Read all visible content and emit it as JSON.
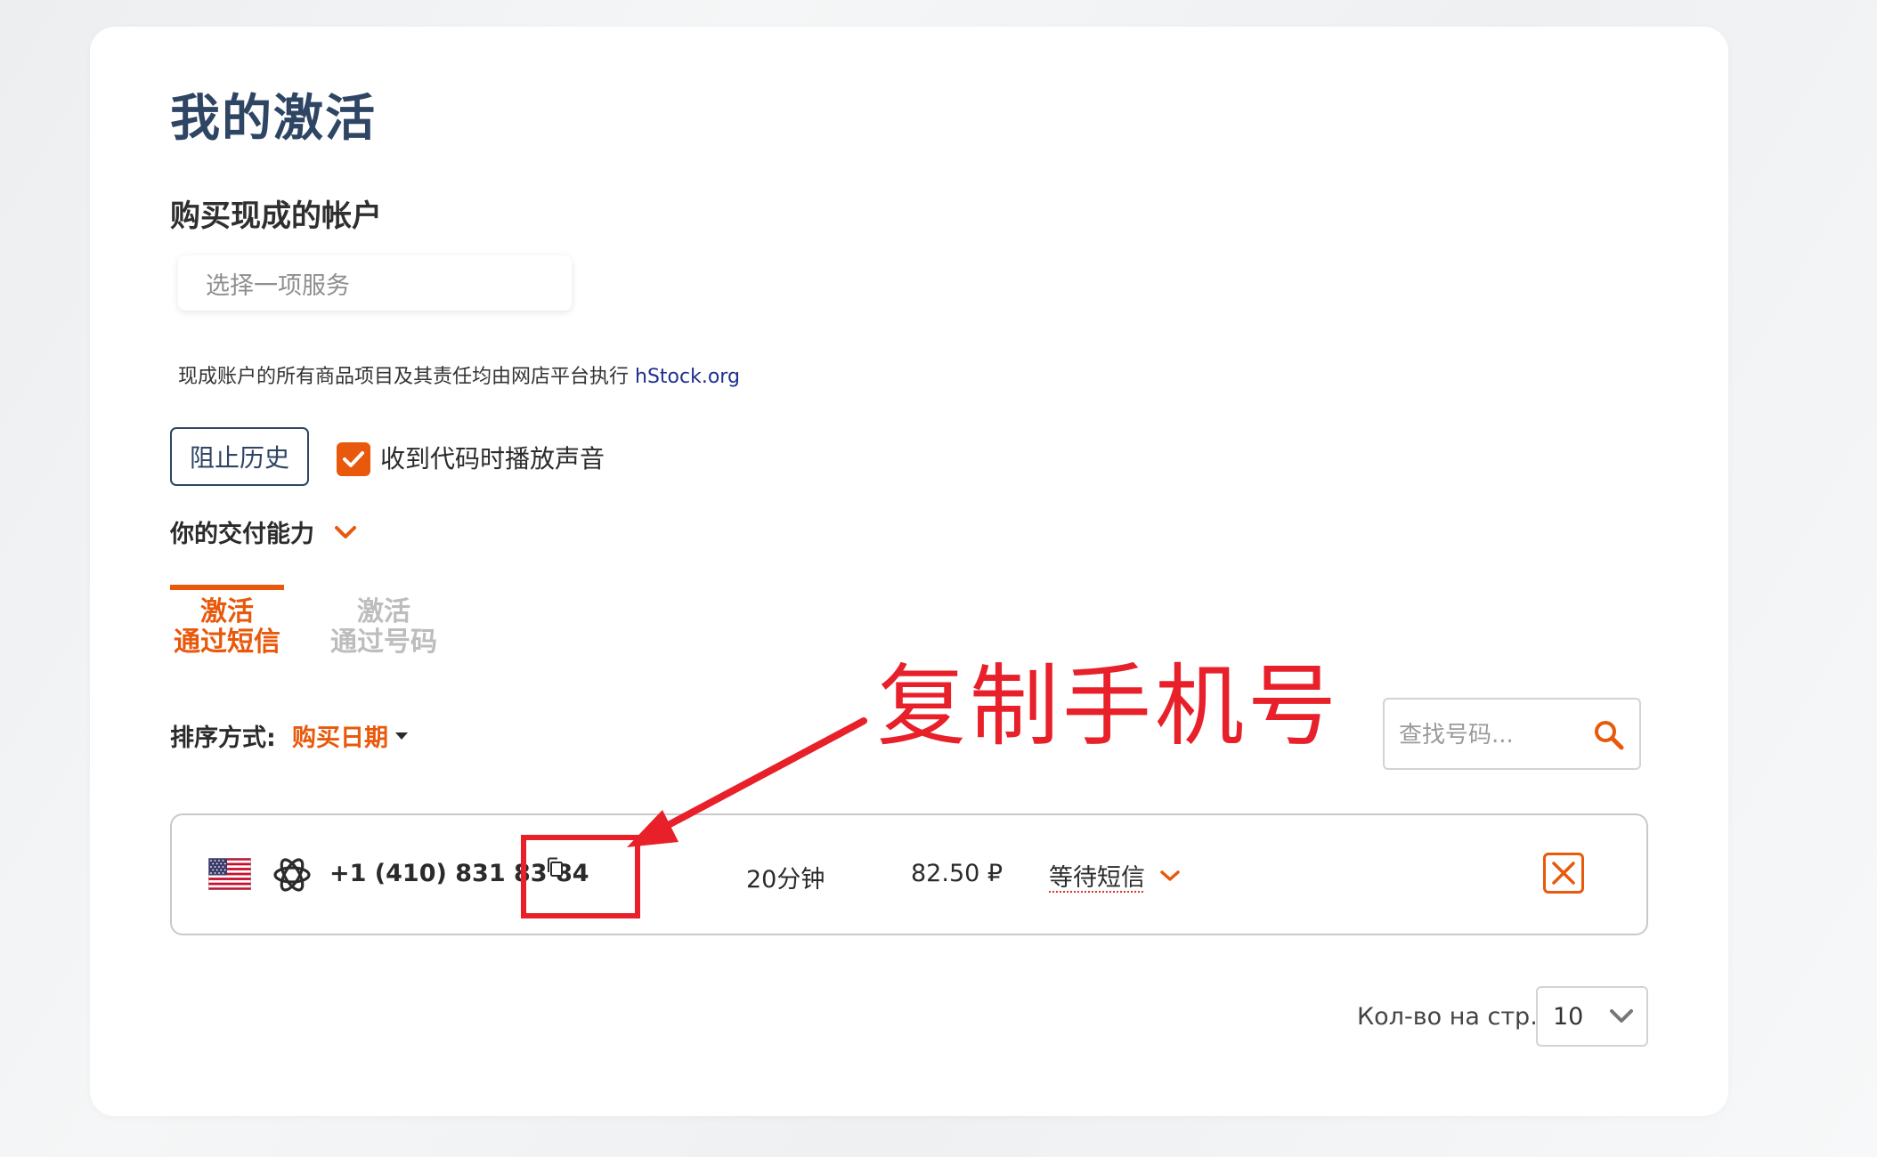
{
  "page": {
    "title": "我的激活"
  },
  "accounts": {
    "section_title": "购买现成的帐户",
    "service_placeholder": "选择一项服务",
    "disclaimer_text": "现成账户的所有商品项目及其责任均由网店平台执行 ",
    "disclaimer_link": "hStock.org"
  },
  "controls": {
    "block_history_label": "阻止历史",
    "sound_checkbox_checked": true,
    "sound_label": "收到代码时播放声音",
    "capabilities_label": "你的交付能力"
  },
  "tabs": [
    {
      "line1": "激活",
      "line2": "通过短信",
      "active": true
    },
    {
      "line1": "激活",
      "line2": "通过号码",
      "active": false
    }
  ],
  "sort": {
    "label": "排序方式:",
    "value": "购买日期"
  },
  "search": {
    "placeholder": "查找号码..."
  },
  "activations": [
    {
      "country_flag": "us-flag-icon",
      "service_icon": "openai-icon",
      "phone": "+1 (410) 831 83 84",
      "duration": "20分钟",
      "price": "82.50 ₽",
      "status": "等待短信"
    }
  ],
  "pagination": {
    "per_page_label": "Кол-во на стр.",
    "per_page_value": "10"
  },
  "annotation": {
    "text": "复制手机号",
    "color": "#e8202a"
  },
  "colors": {
    "accent": "#e8590c",
    "title": "#2e4563",
    "link": "#1d2f8f"
  }
}
